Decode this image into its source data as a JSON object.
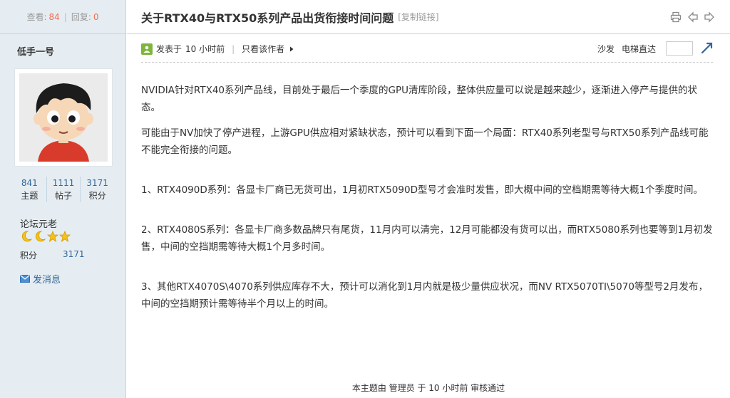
{
  "sidebar": {
    "views_label": "查看:",
    "views_count": "84",
    "replies_label": "回复:",
    "replies_count": "0",
    "author_name": "低手一号",
    "stats": [
      {
        "value": "841",
        "label": "主题"
      },
      {
        "value": "1111",
        "label": "帖子"
      },
      {
        "value": "3171",
        "label": "积分"
      }
    ],
    "rank": "论坛元老",
    "points_label": "积分",
    "points_value": "3171",
    "message_link": "发消息"
  },
  "thread": {
    "title": "关于RTX40与RTX50系列产品出货衔接时间问题",
    "copy_link": "[复制链接]"
  },
  "meta": {
    "posted_prefix": "发表于",
    "posted_time": "10 小时前",
    "only_author": "只看该作者",
    "sofa": "沙发",
    "elevator": "电梯直达"
  },
  "content": {
    "paragraphs": [
      "NVIDIA针对RTX40系列产品线，目前处于最后一个季度的GPU清库阶段，整体供应量可以说是越来越少，逐渐进入停产与提供的状态。",
      "可能由于NV加快了停产进程，上游GPU供应相对紧缺状态，预计可以看到下面一个局面：RTX40系列老型号与RTX50系列产品线可能不能完全衔接的问题。",
      "1、RTX4090D系列：各显卡厂商已无货可出，1月初RTX5090D型号才会准时发售，即大概中间的空档期需等待大概1个季度时间。",
      "2、RTX4080S系列：各显卡厂商多数品牌只有尾货，11月内可以清完，12月可能都没有货可以出，而RTX5080系列也要等到1月初发售，中间的空挡期需等待大概1个月多时间。",
      "3、其他RTX4070S\\4070系列供应库存不大，预计可以消化到1月内就是极少量供应状况，而NV RTX5070TI\\5070等型号2月发布，中间的空挡期预计需等待半个月以上的时间。"
    ],
    "review_note": "本主题由 管理员 于 10 小时前 审核通过"
  },
  "colors": {
    "sidebar_bg": "#e5edf2",
    "border": "#c2d5e3",
    "link": "#336699",
    "accent": "#f26c4f"
  }
}
